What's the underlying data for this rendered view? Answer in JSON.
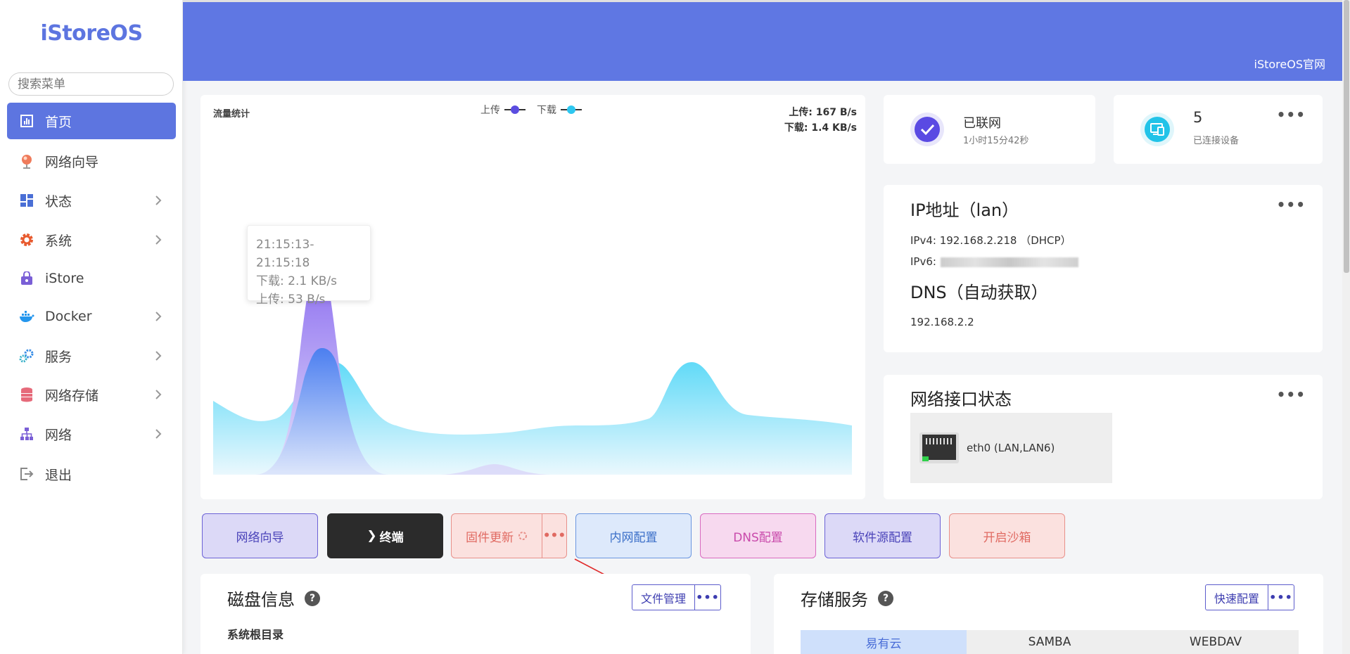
{
  "brand": {
    "logo": "iStoreOS",
    "site_link": "iStoreOS官网",
    "accent": "#5f77e3"
  },
  "sidebar": {
    "search_placeholder": "搜索菜单",
    "items": [
      {
        "label": "首页",
        "icon": "dashboard-icon",
        "active": true,
        "has_children": false
      },
      {
        "label": "网络向导",
        "icon": "globe-icon",
        "has_children": false
      },
      {
        "label": "状态",
        "icon": "grid-icon",
        "has_children": true
      },
      {
        "label": "系统",
        "icon": "gear-icon",
        "has_children": true
      },
      {
        "label": "iStore",
        "icon": "shopping-bag-icon",
        "has_children": false
      },
      {
        "label": "Docker",
        "icon": "docker-icon",
        "has_children": true
      },
      {
        "label": "服务",
        "icon": "services-icon",
        "has_children": true
      },
      {
        "label": "网络存储",
        "icon": "database-icon",
        "has_children": true
      },
      {
        "label": "网络",
        "icon": "network-tree-icon",
        "has_children": true
      },
      {
        "label": "退出",
        "icon": "logout-icon",
        "has_children": false
      }
    ]
  },
  "traffic": {
    "title": "流量统计",
    "legend_upload": "上传",
    "legend_download": "下载",
    "upload_rate": "上传: 167 B/s",
    "download_rate": "下载: 1.4 KB/s",
    "tooltip_time": "21:15:13-21:15:18",
    "tooltip_download": "下载: 2.1 KB/s",
    "tooltip_upload": "上传: 53 B/s",
    "upload_color": "#5b4de0",
    "download_color": "#2ec7f0"
  },
  "network_status": {
    "label": "已联网",
    "uptime": "1小时15分42秒",
    "more": "•••"
  },
  "devices": {
    "count": "5",
    "label": "已连接设备",
    "more": "•••"
  },
  "ip": {
    "title": "IP地址（lan）",
    "ipv4": "IPv4: 192.168.2.218 （DHCP）",
    "ipv6_label": "IPv6:",
    "dns_title": "DNS（自动获取）",
    "dns": "192.168.2.2",
    "more": "•••"
  },
  "interfaces": {
    "title": "网络接口状态",
    "port": "eth0 (LAN,LAN6)",
    "more": "•••"
  },
  "actions": {
    "wizard": "网络向导",
    "terminal": "终端",
    "terminal_prefix": "❯",
    "firmware": "固件更新",
    "more": "•••",
    "lan": "内网配置",
    "dns": "DNS配置",
    "source": "软件源配置",
    "sandbox": "开启沙箱"
  },
  "disk": {
    "title": "磁盘信息",
    "file_manager": "文件管理",
    "more": "•••",
    "root_dir": "系统根目录",
    "help": "?"
  },
  "storage": {
    "title": "存储服务",
    "quick_config": "快速配置",
    "more": "•••",
    "help": "?",
    "tabs": [
      "易有云",
      "SAMBA",
      "WEBDAV"
    ]
  }
}
